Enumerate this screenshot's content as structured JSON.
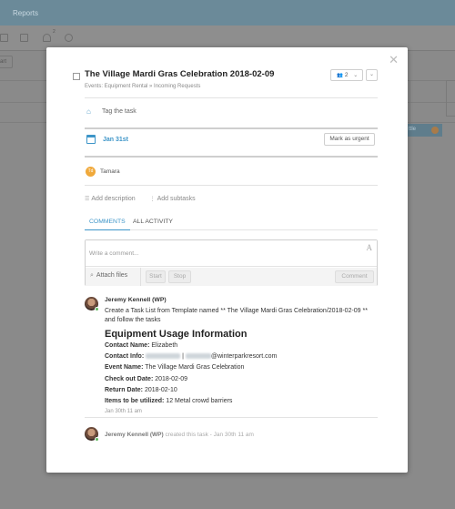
{
  "background": {
    "app_title": "Reports",
    "toolbar_badge": "2",
    "left_button_label": "art",
    "right_chip_label": "ttle"
  },
  "task": {
    "title": "The Village Mardi Gras Celebration 2018-02-09",
    "breadcrumb": "Events: Equipment Rental » Incoming Requests",
    "assignee_count": "2",
    "tag_placeholder": "Tag the task",
    "due_date": "Jan 31st",
    "urgent_label": "Mark as urgent",
    "assignee": {
      "initials": "Td",
      "name": "Tamara"
    },
    "add_description": "Add description",
    "add_subtasks": "Add subtasks"
  },
  "tabs": {
    "comments": "COMMENTS",
    "all_activity": "ALL ACTIVITY"
  },
  "composer": {
    "placeholder": "Write a comment...",
    "attach_label": "Attach files",
    "start_label": "Start",
    "stop_label": "Stop",
    "submit_label": "Comment"
  },
  "comment": {
    "author": "Jeremy Kennell (WP)",
    "text": "Create a Task List from Template named ** The Village Mardi Gras Celebration/2018-02-09 ** and follow the tasks",
    "heading": "Equipment Usage Information",
    "fields": {
      "contact_name_label": "Contact Name:",
      "contact_name_value": "Elizabeth",
      "contact_info_label": "Contact Info:",
      "contact_info_sep": "|",
      "contact_info_email_domain": "@winterparkresort.com",
      "event_name_label": "Event Name:",
      "event_name_value": "The Village Mardi Gras Celebration",
      "checkout_label": "Check out Date:",
      "checkout_value": "2018-02-09",
      "return_label": "Return Date:",
      "return_value": "2018-02-10",
      "items_label": "Items to be utilized:",
      "items_value": "12 Metal crowd barriers"
    },
    "time": "Jan 30th 11 am"
  },
  "activity": {
    "author": "Jeremy Kennell (WP)",
    "action": "created this task",
    "time": "Jan 30th 11 am"
  },
  "colors": {
    "accent": "#3d95c8",
    "avatar_orange": "#f0a93b",
    "online": "#5fb85f"
  },
  "icons": [
    "close-icon",
    "tag-icon",
    "calendar-icon",
    "paperclip-icon",
    "font-format-icon",
    "description-icon",
    "subtasks-icon",
    "people-icon",
    "chevron-down-icon"
  ]
}
